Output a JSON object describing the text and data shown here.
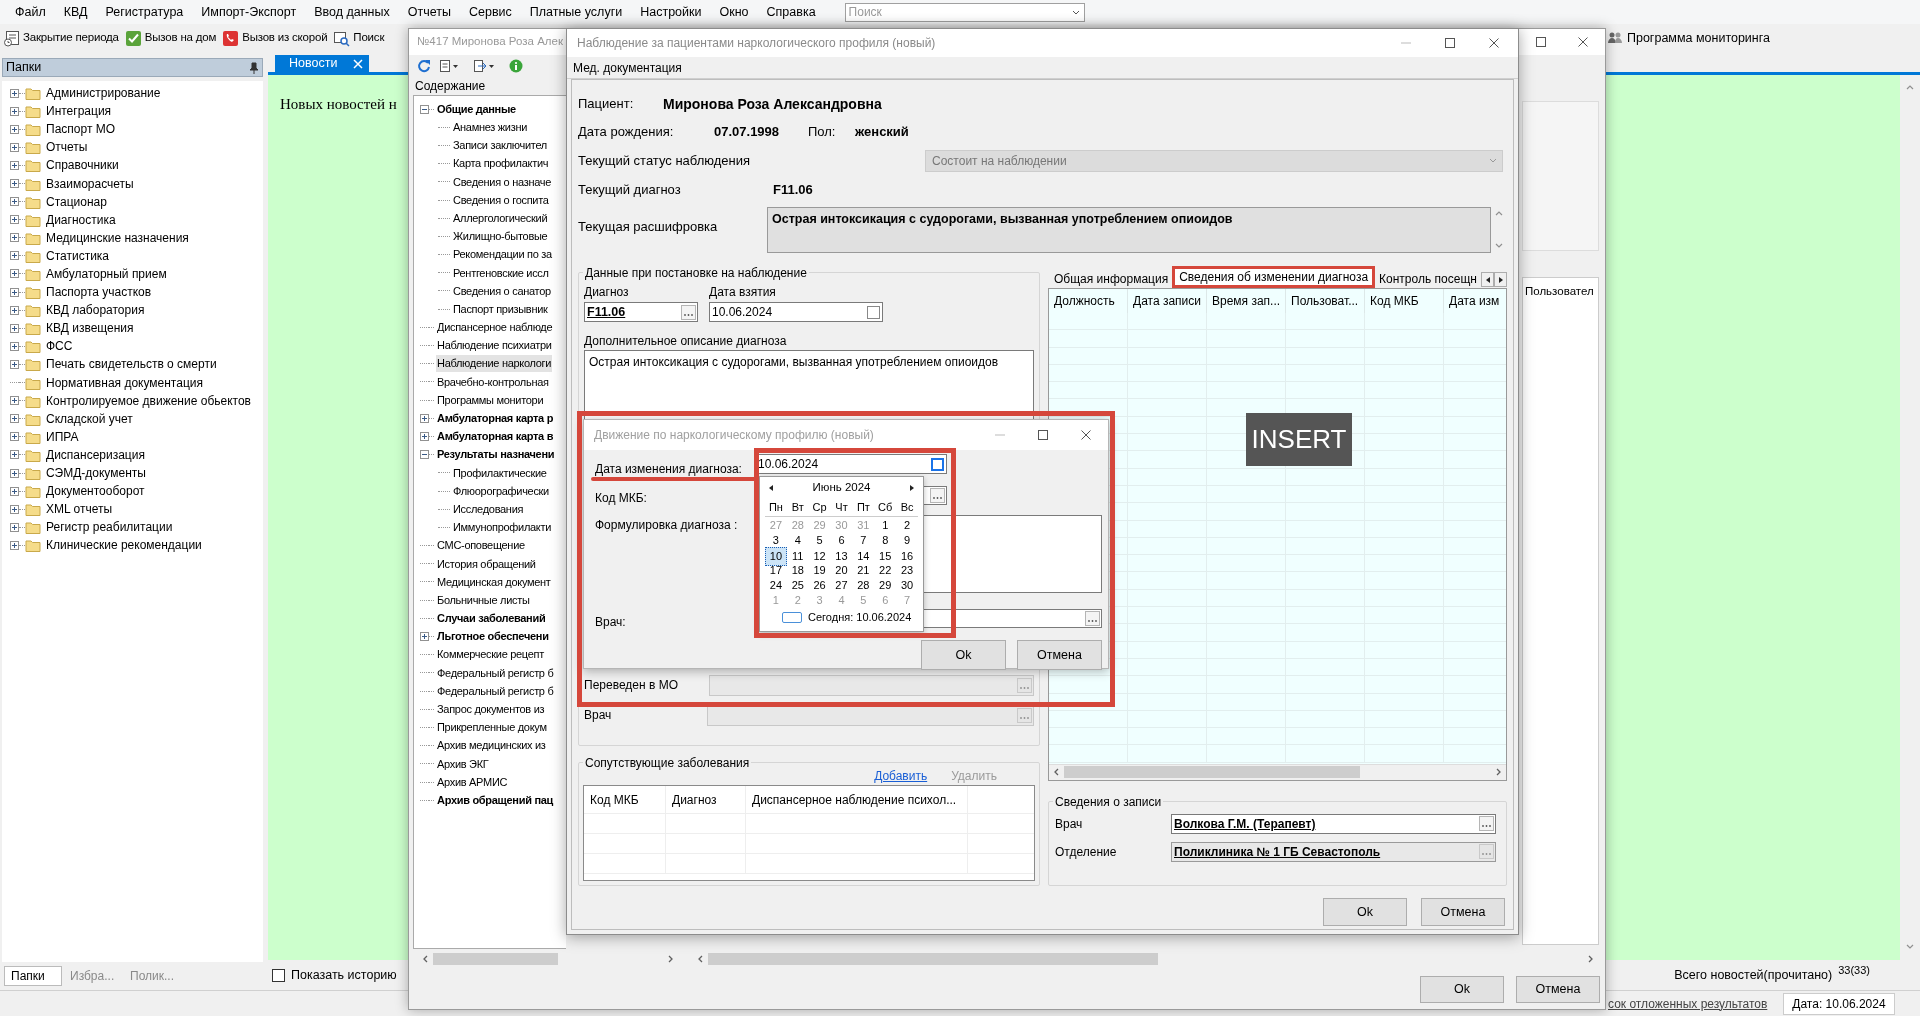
{
  "menu": [
    "Файл",
    "КВД",
    "Регистратура",
    "Импорт-Экспорт",
    "Ввод данных",
    "Отчеты",
    "Сервис",
    "Платные услуги",
    "Настройки",
    "Окно",
    "Справка"
  ],
  "search": {
    "placeholder": "Поиск"
  },
  "toolbar": [
    {
      "kind": "closing",
      "label": "Закрытие периода"
    },
    {
      "kind": "home",
      "label": "Вызов на дом"
    },
    {
      "kind": "ambulance",
      "label": "Вызов из скорой"
    },
    {
      "kind": "search",
      "label": "Поиск"
    }
  ],
  "monitoring_button": "Программа мониторинга",
  "folders": {
    "title": "Папки",
    "items": [
      {
        "label": "Администрирование",
        "expanded": false
      },
      {
        "label": "Интеграция",
        "expanded": false
      },
      {
        "label": "Паспорт МО",
        "expanded": false
      },
      {
        "label": "Отчеты",
        "expanded": false
      },
      {
        "label": "Справочники",
        "expanded": false
      },
      {
        "label": "Взаиморасчеты",
        "expanded": false
      },
      {
        "label": "Стационар",
        "expanded": false
      },
      {
        "label": "Диагностика",
        "expanded": false
      },
      {
        "label": "Медицинские назначения",
        "expanded": false
      },
      {
        "label": "Статистика",
        "expanded": false
      },
      {
        "label": "Амбулаторный прием",
        "expanded": false
      },
      {
        "label": "Паспорта участков",
        "expanded": false
      },
      {
        "label": "КВД лаборатория",
        "expanded": false
      },
      {
        "label": "КВД извещения",
        "expanded": false
      },
      {
        "label": "ФСС",
        "expanded": false
      },
      {
        "label": "Печать свидетельств о смерти",
        "expanded": false
      },
      {
        "label": "Нормативная документация"
      },
      {
        "label": "Контролируемое движение обьектов",
        "expanded": false
      },
      {
        "label": "Складской учет",
        "expanded": false
      },
      {
        "label": "ИПРА",
        "expanded": false
      },
      {
        "label": "Диспансеризация",
        "expanded": false
      },
      {
        "label": "СЭМД-документы",
        "expanded": false
      },
      {
        "label": "Документооборот",
        "expanded": false
      },
      {
        "label": "XML отчеты",
        "expanded": false
      },
      {
        "label": "Регистр реабилитации",
        "expanded": false
      },
      {
        "label": "Клинические рекомендации",
        "expanded": false
      }
    ],
    "tabs": [
      {
        "label": "Папки",
        "selected": true
      },
      {
        "label": "Избра...",
        "selected": false
      },
      {
        "label": "Полик...",
        "selected": false
      }
    ]
  },
  "news": {
    "tab": "Новости",
    "message": "Новых новостей н",
    "show_history": {
      "label": "Показать историю",
      "checked": false
    },
    "total_label": "Всего новостей(прочитано)",
    "total": "33(33)"
  },
  "status_bar": {
    "link": "сок отложенных результатов",
    "date": "Дата: 10.06.2024"
  },
  "patient_window": {
    "title": "№417 Миронова Роза Алек",
    "contents_label": "Содержание",
    "tree": [
      {
        "label": "Общие данные",
        "bold": true,
        "expanded": true,
        "selected": false,
        "children": [
          {
            "label": "Анамнез жизни",
            "selected": false
          },
          {
            "label": "Записи заключител",
            "selected": false
          },
          {
            "label": "Карта профилактич",
            "selected": false
          },
          {
            "label": "Сведения о назначе",
            "selected": false
          },
          {
            "label": "Сведения о госпита",
            "selected": false
          },
          {
            "label": "Аллергологический",
            "selected": false
          },
          {
            "label": "Жилищно-бытовые",
            "selected": false
          },
          {
            "label": "Рекомендации по за",
            "selected": false
          },
          {
            "label": "Рентгеновские иссл",
            "selected": false
          },
          {
            "label": "Сведения о санатор",
            "selected": false
          },
          {
            "label": "Паспорт призывник",
            "selected": false
          }
        ]
      },
      {
        "label": "Диспансерное наблюде",
        "selected": false
      },
      {
        "label": "Наблюдение психиатри",
        "selected": false
      },
      {
        "label": "Наблюдение наркологи",
        "selected": true
      },
      {
        "label": "Врачебно-контрольная",
        "selected": false
      },
      {
        "label": "Программы монитори",
        "selected": false
      },
      {
        "label": "Амбулаторная карта р",
        "bold": true,
        "expanded": false,
        "selected": false
      },
      {
        "label": "Амбулаторная карта в",
        "bold": true,
        "expanded": false,
        "selected": false
      },
      {
        "label": "Результаты назначени",
        "bold": true,
        "expanded": true,
        "selected": false,
        "children": [
          {
            "label": "Профилактические",
            "selected": false
          },
          {
            "label": "Флюорографически",
            "selected": false
          },
          {
            "label": "Исследования",
            "selected": false
          },
          {
            "label": "Иммунопрофилакти",
            "selected": false
          }
        ]
      },
      {
        "label": "СМС-оповещение",
        "selected": false
      },
      {
        "label": "История обращений",
        "selected": false
      },
      {
        "label": "Медицинская документ",
        "selected": false
      },
      {
        "label": "Больничные листы",
        "selected": false
      },
      {
        "label": "Случаи заболеваний",
        "bold": true,
        "selected": false
      },
      {
        "label": "Льготное обеспечени",
        "bold": true,
        "expanded": false,
        "selected": false
      },
      {
        "label": "Коммерческие рецепт",
        "selected": false
      },
      {
        "label": "Федеральный регистр б",
        "selected": false
      },
      {
        "label": "Федеральный регистр б",
        "selected": false
      },
      {
        "label": "Запрос документов из",
        "selected": false
      },
      {
        "label": "Прикрепленные докум",
        "selected": false
      },
      {
        "label": "Архив медицинских из",
        "selected": false
      },
      {
        "label": "Архив ЭКГ",
        "selected": false
      },
      {
        "label": "Архив АРМИС",
        "selected": false
      },
      {
        "label": "Архив обращений пац",
        "bold": true,
        "selected": false
      }
    ],
    "side_column": "Пользовател",
    "buttons": [
      "Ok",
      "Отмена"
    ]
  },
  "observation": {
    "title": "Наблюдение за пациентами наркологического профиля (новый)",
    "menu": "Мед. документация",
    "patient_label": "Пациент:",
    "patient": "Миронова Роза Александровна",
    "birth_label": "Дата рождения:",
    "birth": "07.07.1998",
    "sex_label": "Пол:",
    "sex": "женский",
    "status_label": "Текущий статус наблюдения",
    "status": {
      "value": "Состоит на наблюдении",
      "disabled": true
    },
    "diagnosis_label": "Текущий диагноз",
    "diagnosis": "F11.06",
    "decoding_label": "Текущая расшифровка",
    "decoding": "Острая интоксикация с судорогами, вызванная употреблением опиоидов",
    "registration": {
      "title": "Данные при постановке на наблюдение",
      "diagnosis_label": "Диагноз",
      "diagnosis": "F11.06",
      "date_label": "Дата взятия",
      "date": "10.06.2024",
      "description_label": "Дополнительное описание диагноза",
      "description": "Острая интоксикация с судорогами, вызванная употреблением опиоидов",
      "transferred_label": "Переведен в МО",
      "doctor_label": "Врач"
    },
    "comorbid": {
      "title": "Сопутствующие заболевания",
      "add": "Добавить",
      "remove": {
        "label": "Удалить",
        "disabled": true
      },
      "columns": [
        "Код МКБ",
        "Диагноз",
        "Диспансерное наблюдение психол..."
      ]
    },
    "tabs": [
      {
        "label": "Общая информация",
        "selected": false
      },
      {
        "label": "Сведения об изменении диагноза",
        "selected": true
      },
      {
        "label": "Контроль посещн",
        "selected": false
      }
    ],
    "grid_columns": [
      "Должность",
      "Дата записи",
      "Время зап...",
      "Пользоват...",
      "Код МКБ",
      "Дата изм"
    ],
    "record": {
      "title": "Сведения о записи",
      "doctor_label": "Врач",
      "doctor": "Волкова Г.М. (Терапевт)",
      "department_label": "Отделение",
      "department": "Поликлиника № 1 ГБ Севастополь"
    },
    "buttons": [
      "Ok",
      "Отмена"
    ]
  },
  "movement": {
    "title": "Движение по наркологическому профилю (новый)",
    "date_label": "Дата изменения диагноза:",
    "date": "10.06.2024",
    "icd_label": "Код МКБ:",
    "wording_label": "Формулировка диагноза :",
    "doctor_label": "Врач:",
    "buttons": [
      "Ok",
      "Отмена"
    ],
    "calendar": {
      "month": "Июнь 2024",
      "weekdays": [
        "Пн",
        "Вт",
        "Ср",
        "Чт",
        "Пт",
        "Сб",
        "Вс"
      ],
      "weeks": [
        [
          {
            "day": "27",
            "muted": true,
            "selected": false
          },
          {
            "day": "28",
            "muted": true,
            "selected": false
          },
          {
            "day": "29",
            "muted": true,
            "selected": false
          },
          {
            "day": "30",
            "muted": true,
            "selected": false
          },
          {
            "day": "31",
            "muted": true,
            "selected": false
          },
          {
            "day": "1",
            "muted": false,
            "selected": false
          },
          {
            "day": "2",
            "muted": false,
            "selected": false
          }
        ],
        [
          {
            "day": "3",
            "muted": false,
            "selected": false
          },
          {
            "day": "4",
            "muted": false,
            "selected": false
          },
          {
            "day": "5",
            "muted": false,
            "selected": false
          },
          {
            "day": "6",
            "muted": false,
            "selected": false
          },
          {
            "day": "7",
            "muted": false,
            "selected": false
          },
          {
            "day": "8",
            "muted": false,
            "selected": false
          },
          {
            "day": "9",
            "muted": false,
            "selected": false
          }
        ],
        [
          {
            "day": "10",
            "muted": false,
            "selected": true
          },
          {
            "day": "11",
            "muted": false,
            "selected": false
          },
          {
            "day": "12",
            "muted": false,
            "selected": false
          },
          {
            "day": "13",
            "muted": false,
            "selected": false
          },
          {
            "day": "14",
            "muted": false,
            "selected": false
          },
          {
            "day": "15",
            "muted": false,
            "selected": false
          },
          {
            "day": "16",
            "muted": false,
            "selected": false
          }
        ],
        [
          {
            "day": "17",
            "muted": false,
            "selected": false
          },
          {
            "day": "18",
            "muted": false,
            "selected": false
          },
          {
            "day": "19",
            "muted": false,
            "selected": false
          },
          {
            "day": "20",
            "muted": false,
            "selected": false
          },
          {
            "day": "21",
            "muted": false,
            "selected": false
          },
          {
            "day": "22",
            "muted": false,
            "selected": false
          },
          {
            "day": "23",
            "muted": false,
            "selected": false
          }
        ],
        [
          {
            "day": "24",
            "muted": false,
            "selected": false
          },
          {
            "day": "25",
            "muted": false,
            "selected": false
          },
          {
            "day": "26",
            "muted": false,
            "selected": false
          },
          {
            "day": "27",
            "muted": false,
            "selected": false
          },
          {
            "day": "28",
            "muted": false,
            "selected": false
          },
          {
            "day": "29",
            "muted": false,
            "selected": false
          },
          {
            "day": "30",
            "muted": false,
            "selected": false
          }
        ],
        [
          {
            "day": "1",
            "muted": true,
            "selected": false
          },
          {
            "day": "2",
            "muted": true,
            "selected": false
          },
          {
            "day": "3",
            "muted": true,
            "selected": false
          },
          {
            "day": "4",
            "muted": true,
            "selected": false
          },
          {
            "day": "5",
            "muted": true,
            "selected": false
          },
          {
            "day": "6",
            "muted": true,
            "selected": false
          },
          {
            "day": "7",
            "muted": true,
            "selected": false
          }
        ]
      ],
      "today": "Сегодня: 10.06.2024"
    }
  },
  "mode_indicator": "INSERT"
}
